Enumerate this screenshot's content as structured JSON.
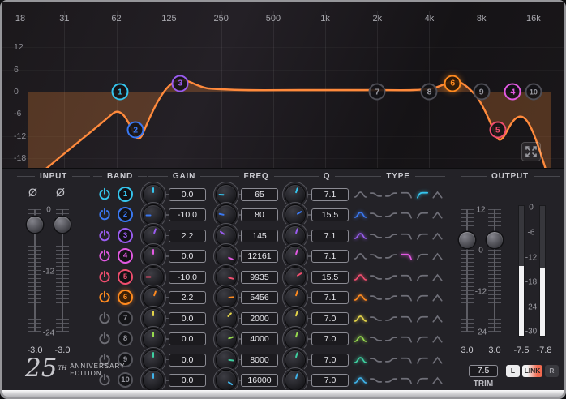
{
  "graph": {
    "freq_ticks": [
      {
        "label": "18",
        "hz": 18
      },
      {
        "label": "31",
        "hz": 31
      },
      {
        "label": "62",
        "hz": 62
      },
      {
        "label": "125",
        "hz": 125
      },
      {
        "label": "250",
        "hz": 250
      },
      {
        "label": "500",
        "hz": 500
      },
      {
        "label": "1k",
        "hz": 1000
      },
      {
        "label": "2k",
        "hz": 2000
      },
      {
        "label": "4k",
        "hz": 4000
      },
      {
        "label": "8k",
        "hz": 8000
      },
      {
        "label": "16k",
        "hz": 16000
      }
    ],
    "db_ticks": [
      {
        "label": "12",
        "db": 12
      },
      {
        "label": "6",
        "db": 6
      },
      {
        "label": "0",
        "db": 0
      },
      {
        "label": "-6",
        "db": -6
      },
      {
        "label": "-12",
        "db": -12
      },
      {
        "label": "-18",
        "db": -18
      }
    ],
    "curve_color": "#ff8a3c",
    "fill_color": "rgba(216,122,52,0.30)"
  },
  "sections": {
    "input": "INPUT",
    "band": "BAND",
    "gain": "GAIN",
    "freq": "FREQ",
    "q": "Q",
    "type": "TYPE",
    "output": "OUTPUT"
  },
  "input": {
    "phase_left": "Ø",
    "phase_right": "Ø",
    "scale": [
      "0",
      "-12",
      "-24"
    ],
    "value_left": "-3.0",
    "value_right": "-3.0"
  },
  "type_options": [
    "bell",
    "shelf-down",
    "shelf-up",
    "high-cut",
    "low-cut",
    "notch"
  ],
  "bands": [
    {
      "num": "1",
      "enabled": true,
      "selected": false,
      "color": "#35c5ee",
      "gain": "0.0",
      "freq": "65",
      "q": "7.1",
      "type": "low-cut",
      "type_index": 4
    },
    {
      "num": "2",
      "enabled": true,
      "selected": false,
      "color": "#3a78f2",
      "gain": "-10.0",
      "freq": "80",
      "q": "15.5",
      "type": "bell",
      "type_index": 0
    },
    {
      "num": "3",
      "enabled": true,
      "selected": false,
      "color": "#9a5cf0",
      "gain": "2.2",
      "freq": "145",
      "q": "7.1",
      "type": "bell",
      "type_index": 0
    },
    {
      "num": "4",
      "enabled": true,
      "selected": false,
      "color": "#e259e2",
      "gain": "0.0",
      "freq": "12161",
      "q": "7.1",
      "type": "high-cut",
      "type_index": 3
    },
    {
      "num": "5",
      "enabled": true,
      "selected": false,
      "color": "#f04e6e",
      "gain": "-10.0",
      "freq": "9935",
      "q": "15.5",
      "type": "bell",
      "type_index": 0
    },
    {
      "num": "6",
      "enabled": true,
      "selected": true,
      "color": "#ff8a1f",
      "gain": "2.2",
      "freq": "5456",
      "q": "7.1",
      "type": "bell",
      "type_index": 0
    },
    {
      "num": "7",
      "enabled": false,
      "selected": false,
      "color": "#e3d44a",
      "gain": "0.0",
      "freq": "2000",
      "q": "7.0",
      "type": "bell",
      "type_index": 0
    },
    {
      "num": "8",
      "enabled": false,
      "selected": false,
      "color": "#96d94e",
      "gain": "0.0",
      "freq": "4000",
      "q": "7.0",
      "type": "bell",
      "type_index": 0
    },
    {
      "num": "9",
      "enabled": false,
      "selected": false,
      "color": "#3ecfa0",
      "gain": "0.0",
      "freq": "8000",
      "q": "7.0",
      "type": "bell",
      "type_index": 0
    },
    {
      "num": "10",
      "enabled": false,
      "selected": false,
      "color": "#3fb2e8",
      "gain": "0.0",
      "freq": "16000",
      "q": "7.0",
      "type": "bell",
      "type_index": 0
    }
  ],
  "output": {
    "fader_scale": [
      "12",
      "0",
      "-12",
      "-24"
    ],
    "fader_left": "3.0",
    "fader_right": "3.0",
    "meter_scale": [
      "0",
      "-6",
      "-12",
      "-18",
      "-24",
      "-30"
    ],
    "meter_left": "-7.5",
    "meter_right": "-7.8",
    "trim_value": "7.5",
    "trim_label": "TRIM",
    "left_button": "L",
    "link_button": "LINK",
    "right_button": "R"
  },
  "logo": {
    "number": "25",
    "suffix": "TH",
    "line1": "ANNIVERSARY",
    "line2": "EDITION"
  }
}
